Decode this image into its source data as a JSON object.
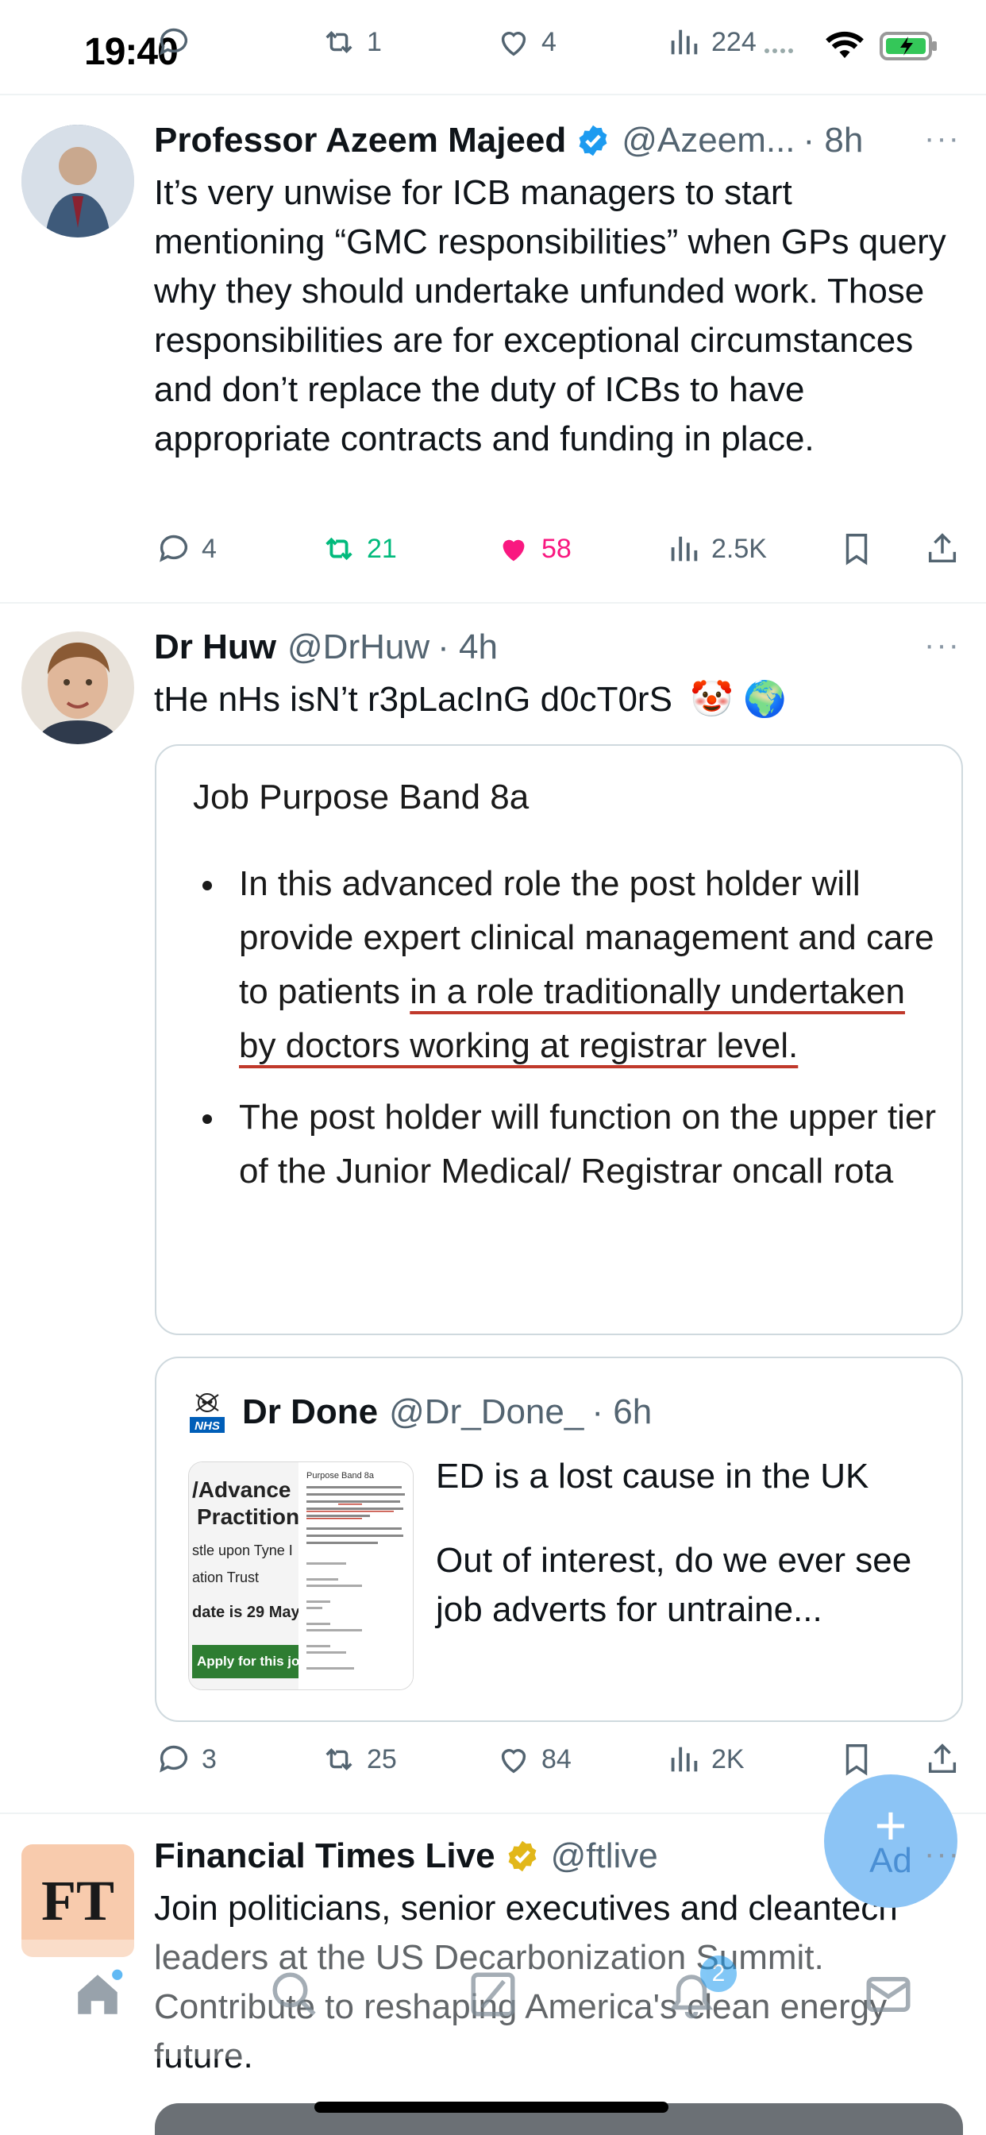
{
  "status_bar": {
    "time": "19:40"
  },
  "prev_tweet": {
    "replies": "",
    "retweets": "1",
    "likes": "4",
    "views": "224"
  },
  "tweet1": {
    "name": "Professor Azeem Majeed",
    "handle": "@Azeem...",
    "time": "· 8h",
    "body": "It’s very unwise for ICB managers to start mentioning “GMC responsibilities” when GPs query why they should undertake unfunded work. Those responsibilities are for exceptional circumstances and don’t replace the duty of ICBs to have appropriate contracts and funding in place.",
    "replies": "4",
    "retweets": "21",
    "likes": "58",
    "views": "2.5K"
  },
  "tweet2": {
    "name": "Dr Huw",
    "handle": "@DrHuw",
    "time": "· 4h",
    "body": "tHe nHs isN’t r3pLacInG d0cT0rS",
    "emoji": "🤡 🌍",
    "image": {
      "title": "Job Purpose Band 8a",
      "bullet1_plain": "In this advanced role the post holder will provide expert clinical management and care to patients ",
      "bullet1_underlined": "in a role traditionally undertaken by doctors working at registrar level.",
      "bullet2": "The post holder will function on the upper tier of the Junior Medical/ Registrar oncall rota"
    },
    "quote": {
      "name": "Dr Done",
      "handle": "@Dr_Done_",
      "time": "· 6h",
      "text_line1": "ED is a lost cause in the UK",
      "text_line2": "Out of interest, do we ever see job adverts for untraine...",
      "thumb": {
        "left_lines": [
          "/Advance",
          "Practition",
          "stle upon Tyne I",
          "ation Trust",
          "date is 29 May"
        ],
        "apply": "Apply for this job",
        "right_title": "Purpose Band 8a"
      }
    },
    "replies": "3",
    "retweets": "25",
    "likes": "84",
    "views": "2K"
  },
  "fab": {
    "label": "Ad"
  },
  "tweet3": {
    "avatar_text": "FT",
    "name": "Financial Times Live",
    "handle": "@ftlive",
    "body": "Join politicians, senior executives and cleantech leaders at the US Decarbonization Summit. Contribute to reshaping America's clean energy future."
  },
  "tab_bar": {
    "notifications_badge": "2"
  },
  "colors": {
    "retweet_active": "#00ba7c",
    "like_active": "#f91880",
    "verified_blue": "#1d9bf0",
    "verified_gold": "#e2b719"
  }
}
